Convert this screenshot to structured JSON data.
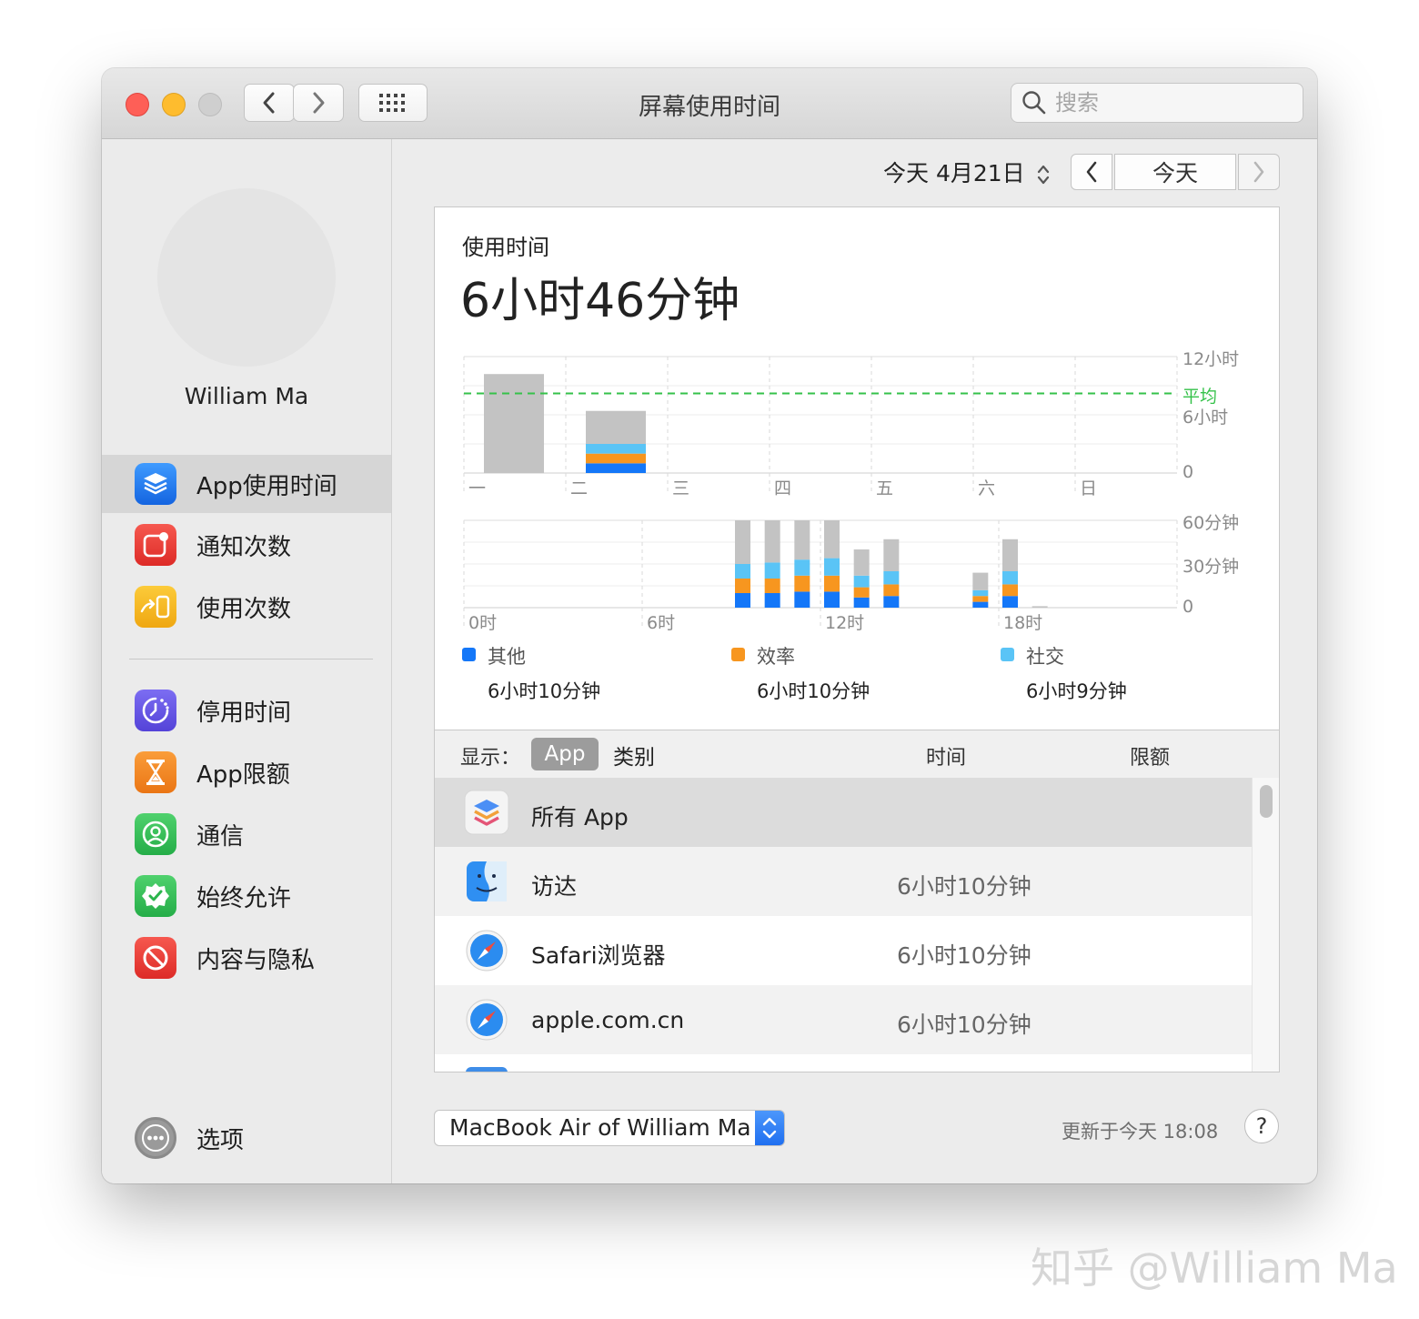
{
  "window": {
    "title": "屏幕使用时间",
    "search_placeholder": "搜索"
  },
  "sidebar": {
    "user_name": "William Ma",
    "items": [
      {
        "label": "App使用时间",
        "icon": "layers-icon",
        "color": "#1a7cf0",
        "active": true
      },
      {
        "label": "通知次数",
        "icon": "notification-icon",
        "color": "#e8403a"
      },
      {
        "label": "使用次数",
        "icon": "pickups-icon",
        "color": "#f2b51c"
      },
      {
        "label": "停用时间",
        "icon": "downtime-icon",
        "color": "#6a5be6"
      },
      {
        "label": "App限额",
        "icon": "hourglass-icon",
        "color": "#f08a24"
      },
      {
        "label": "通信",
        "icon": "contact-icon",
        "color": "#34c05a"
      },
      {
        "label": "始终允许",
        "icon": "checkmark-badge-icon",
        "color": "#34c05a"
      },
      {
        "label": "内容与隐私",
        "icon": "restriction-icon",
        "color": "#e8403a"
      }
    ],
    "options_label": "选项"
  },
  "date_nav": {
    "date_label": "今天 4月21日",
    "today_button": "今天"
  },
  "usage": {
    "title": "使用时间",
    "total": "6小时46分钟"
  },
  "colors": {
    "other": "#1477f8",
    "productivity": "#f7961f",
    "social": "#5ac4f6",
    "remainder": "#c3c3c3",
    "average_line": "#35c24a"
  },
  "chart_data": [
    {
      "type": "bar",
      "stacked": true,
      "categories": [
        "一",
        "二",
        "三",
        "四",
        "五",
        "六",
        "日"
      ],
      "series": [
        {
          "name": "其他",
          "values": [
            0,
            1,
            0,
            0,
            0,
            0,
            0
          ]
        },
        {
          "name": "效率",
          "values": [
            0,
            1,
            0,
            0,
            0,
            0,
            0
          ]
        },
        {
          "name": "社交",
          "values": [
            0,
            1,
            0,
            0,
            0,
            0,
            0
          ]
        },
        {
          "values": [
            10.2,
            3.4,
            0,
            0,
            0,
            0,
            0
          ]
        }
      ],
      "ylim": [
        0,
        12
      ],
      "yticks": [
        {
          "value": 12,
          "label": "12小时"
        },
        {
          "value": 6,
          "label": "6小时"
        },
        {
          "value": 0,
          "label": "0"
        }
      ],
      "average": {
        "value": 8.2,
        "label": "平均"
      }
    },
    {
      "type": "bar",
      "stacked": true,
      "x": [
        9,
        10,
        11,
        12,
        13,
        14,
        17,
        18,
        19
      ],
      "xticks": [
        {
          "value": 0,
          "label": "0时"
        },
        {
          "value": 6,
          "label": "6时"
        },
        {
          "value": 12,
          "label": "12时"
        },
        {
          "value": 18,
          "label": "18时"
        }
      ],
      "series": [
        {
          "name": "其他",
          "values": [
            10,
            10,
            11,
            11,
            7,
            8,
            4,
            8,
            0
          ]
        },
        {
          "name": "效率",
          "values": [
            10,
            10,
            11,
            11,
            7,
            8,
            4,
            8,
            0
          ]
        },
        {
          "name": "社交",
          "values": [
            10,
            11,
            11,
            12,
            8,
            9,
            4,
            9,
            0
          ]
        },
        {
          "values": [
            30,
            29,
            27,
            26,
            18,
            22,
            12,
            22,
            1
          ]
        }
      ],
      "ylim": [
        0,
        60
      ],
      "yticks": [
        {
          "value": 60,
          "label": "60分钟"
        },
        {
          "value": 30,
          "label": "30分钟"
        },
        {
          "value": 0,
          "label": "0"
        }
      ]
    }
  ],
  "legend": [
    {
      "name": "其他",
      "value": "6小时10分钟",
      "color": "#1477f8"
    },
    {
      "name": "效率",
      "value": "6小时10分钟",
      "color": "#f7961f"
    },
    {
      "name": "社交",
      "value": "6小时9分钟",
      "color": "#5ac4f6"
    }
  ],
  "table": {
    "show_label": "显示：",
    "seg_app": "App",
    "seg_category": "类别",
    "col_time": "时间",
    "col_limit": "限额",
    "rows": [
      {
        "name": "所有 App",
        "time": "",
        "icon": "all-apps-icon"
      },
      {
        "name": "访达",
        "time": "6小时10分钟",
        "icon": "finder-icon"
      },
      {
        "name": "Safari浏览器",
        "time": "6小时10分钟",
        "icon": "safari-icon"
      },
      {
        "name": "apple.com.cn",
        "time": "6小时10分钟",
        "icon": "safari-icon"
      }
    ]
  },
  "footer": {
    "device": "MacBook Air of William Ma",
    "updated": "更新于今天 18:08",
    "help": "?"
  },
  "watermark": "知乎 @William Ma"
}
